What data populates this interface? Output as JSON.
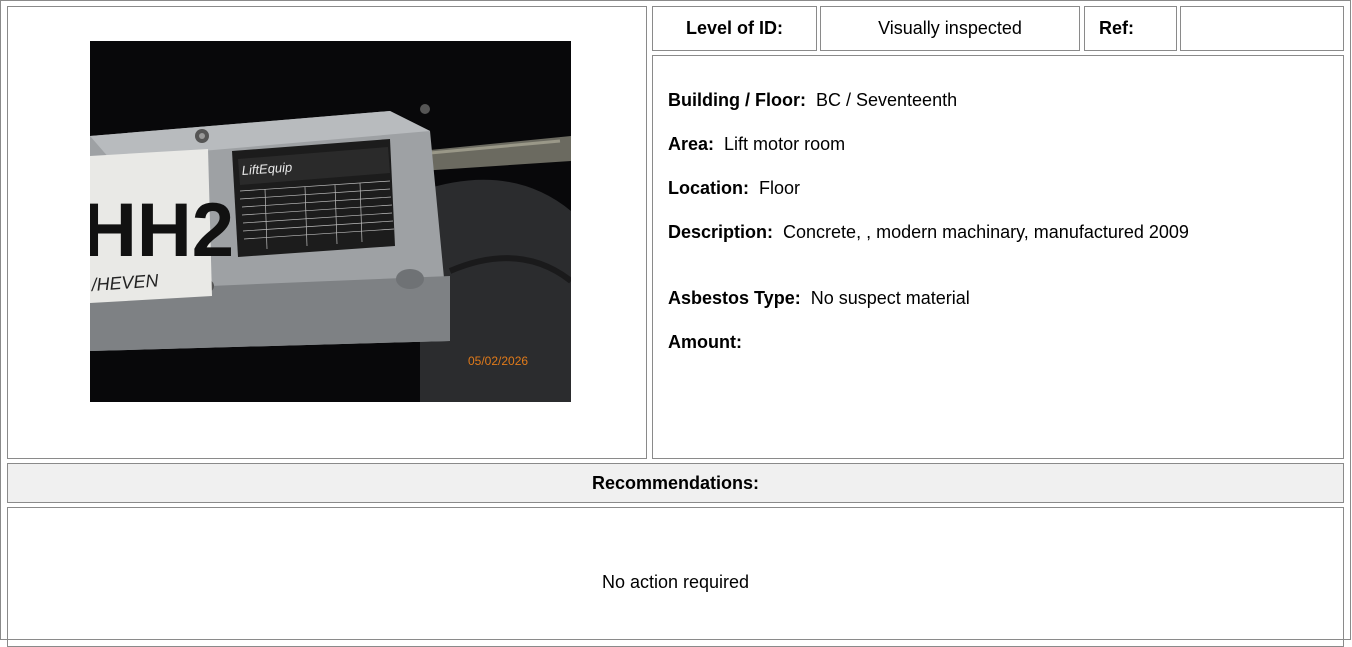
{
  "level_of_id": {
    "label": "Level of ID:",
    "value": "Visually inspected"
  },
  "ref": {
    "label": "Ref:",
    "value": ""
  },
  "details": {
    "building_floor": {
      "label": "Building / Floor:",
      "value": "BC / Seventeenth"
    },
    "area": {
      "label": "Area:",
      "value": "Lift motor room"
    },
    "location": {
      "label": "Location:",
      "value": "Floor"
    },
    "description": {
      "label": "Description:",
      "value": "Concrete, , modern machinary, manufactured 2009"
    },
    "asbestos_type": {
      "label": "Asbestos Type:",
      "value": "No suspect material"
    },
    "amount": {
      "label": "Amount:",
      "value": ""
    }
  },
  "recommendations": {
    "header": "Recommendations:",
    "text": "No action required"
  },
  "photo": {
    "sign_text": "HH2",
    "handwriting": "/HEVEN",
    "plate_brand": "LiftEquip",
    "date_stamp": "05/02/2026"
  }
}
